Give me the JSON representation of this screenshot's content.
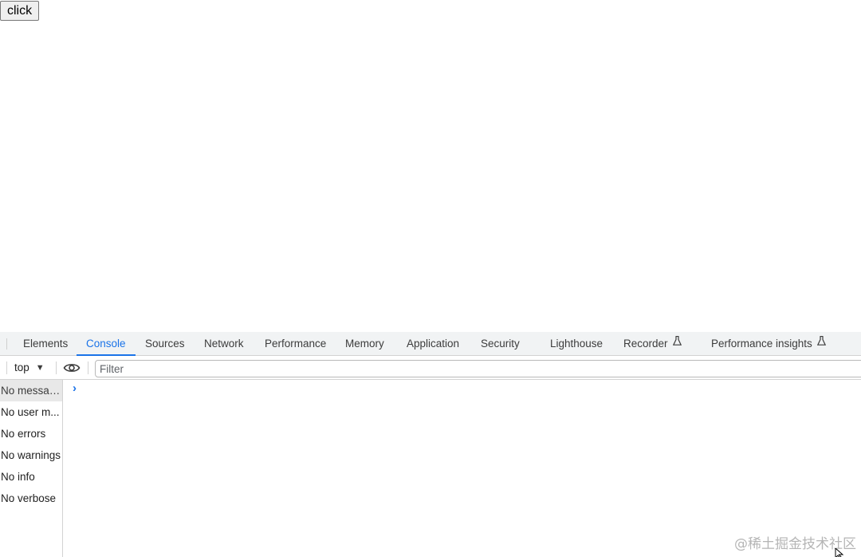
{
  "page": {
    "button_label": "click"
  },
  "devtools": {
    "tabs": [
      {
        "label": "Elements",
        "active": false
      },
      {
        "label": "Console",
        "active": true
      },
      {
        "label": "Sources",
        "active": false
      },
      {
        "label": "Network",
        "active": false
      },
      {
        "label": "Performance",
        "active": false
      },
      {
        "label": "Memory",
        "active": false
      },
      {
        "label": "Application",
        "active": false
      },
      {
        "label": "Security",
        "active": false
      },
      {
        "label": "Lighthouse",
        "active": false
      },
      {
        "label": "Recorder",
        "active": false,
        "experimental": true
      },
      {
        "label": "Performance insights",
        "active": false,
        "experimental": true
      }
    ],
    "toolbar": {
      "context": "top",
      "filter_placeholder": "Filter"
    },
    "sidebar": {
      "items": [
        {
          "label": "No messag...",
          "selected": true
        },
        {
          "label": "No user m...",
          "selected": false
        },
        {
          "label": "No errors",
          "selected": false
        },
        {
          "label": "No warnings",
          "selected": false
        },
        {
          "label": "No info",
          "selected": false
        },
        {
          "label": "No verbose",
          "selected": false
        }
      ]
    },
    "icons": {
      "context_caret": "caret-down-icon",
      "live_expression": "eye-icon",
      "experimental": "flask-icon",
      "prompt": "chevron-right-icon"
    },
    "colors": {
      "accent": "#1a73e8",
      "tab_bar": "#f1f3f4"
    }
  },
  "watermark": "@稀土掘金技术社区"
}
